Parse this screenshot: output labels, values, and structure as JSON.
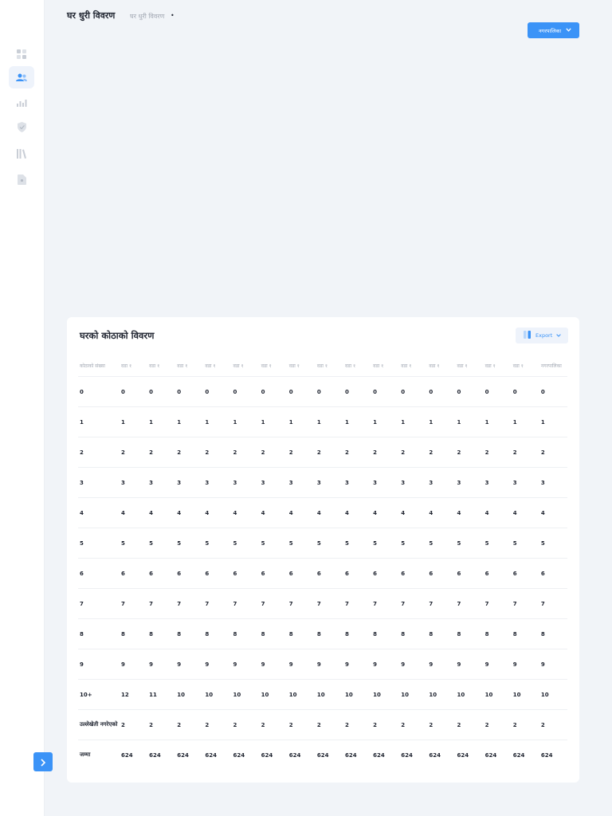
{
  "header": {
    "title": "घर धुरी विवरण",
    "breadcrumb": "घर धुरी विवरण",
    "breadcrumb_dot": "•",
    "municipality_button": "नगरपालिका"
  },
  "sidebar": {
    "icons": [
      "dashboard-icon",
      "users-icon",
      "bar-chart-icon",
      "shield-check-icon",
      "library-icon",
      "document-icon"
    ],
    "active_index": 1
  },
  "colors": {
    "accent": "#3b93f7",
    "background": "#f1f4f8",
    "card": "#ffffff"
  },
  "card": {
    "title": "घरको कोठाको विवरण",
    "export_label": "Export"
  },
  "table": {
    "headers": [
      "कोठाको संख्या",
      "वडा १",
      "वडा १",
      "वडा १",
      "वडा १",
      "वडा १",
      "वडा १",
      "वडा १",
      "वडा १",
      "वडा १",
      "वडा १",
      "वडा १",
      "वडा १",
      "वडा १",
      "वडा १",
      "वडा १",
      "नगरपालिका"
    ],
    "rows": [
      [
        "0",
        "0",
        "0",
        "0",
        "0",
        "0",
        "0",
        "0",
        "0",
        "0",
        "0",
        "0",
        "0",
        "0",
        "0",
        "0",
        "0"
      ],
      [
        "1",
        "1",
        "1",
        "1",
        "1",
        "1",
        "1",
        "1",
        "1",
        "1",
        "1",
        "1",
        "1",
        "1",
        "1",
        "1",
        "1"
      ],
      [
        "2",
        "2",
        "2",
        "2",
        "2",
        "2",
        "2",
        "2",
        "2",
        "2",
        "2",
        "2",
        "2",
        "2",
        "2",
        "2",
        "2"
      ],
      [
        "3",
        "3",
        "3",
        "3",
        "3",
        "3",
        "3",
        "3",
        "3",
        "3",
        "3",
        "3",
        "3",
        "3",
        "3",
        "3",
        "3"
      ],
      [
        "4",
        "4",
        "4",
        "4",
        "4",
        "4",
        "4",
        "4",
        "4",
        "4",
        "4",
        "4",
        "4",
        "4",
        "4",
        "4",
        "4"
      ],
      [
        "5",
        "5",
        "5",
        "5",
        "5",
        "5",
        "5",
        "5",
        "5",
        "5",
        "5",
        "5",
        "5",
        "5",
        "5",
        "5",
        "5"
      ],
      [
        "6",
        "6",
        "6",
        "6",
        "6",
        "6",
        "6",
        "6",
        "6",
        "6",
        "6",
        "6",
        "6",
        "6",
        "6",
        "6",
        "6"
      ],
      [
        "7",
        "7",
        "7",
        "7",
        "7",
        "7",
        "7",
        "7",
        "7",
        "7",
        "7",
        "7",
        "7",
        "7",
        "7",
        "7",
        "7"
      ],
      [
        "8",
        "8",
        "8",
        "8",
        "8",
        "8",
        "8",
        "8",
        "8",
        "8",
        "8",
        "8",
        "8",
        "8",
        "8",
        "8",
        "8"
      ],
      [
        "9",
        "9",
        "9",
        "9",
        "9",
        "9",
        "9",
        "9",
        "9",
        "9",
        "9",
        "9",
        "9",
        "9",
        "9",
        "9",
        "9"
      ],
      [
        "10+",
        "12",
        "11",
        "10",
        "10",
        "10",
        "10",
        "10",
        "10",
        "10",
        "10",
        "10",
        "10",
        "10",
        "10",
        "10",
        "10"
      ],
      [
        "उल्लेखेती नगरेएको",
        "2",
        "2",
        "2",
        "2",
        "2",
        "2",
        "2",
        "2",
        "2",
        "2",
        "2",
        "2",
        "2",
        "2",
        "2",
        "2"
      ],
      [
        "जम्मा",
        "624",
        "624",
        "624",
        "624",
        "624",
        "624",
        "624",
        "624",
        "624",
        "624",
        "624",
        "624",
        "624",
        "624",
        "624",
        "624"
      ]
    ]
  }
}
